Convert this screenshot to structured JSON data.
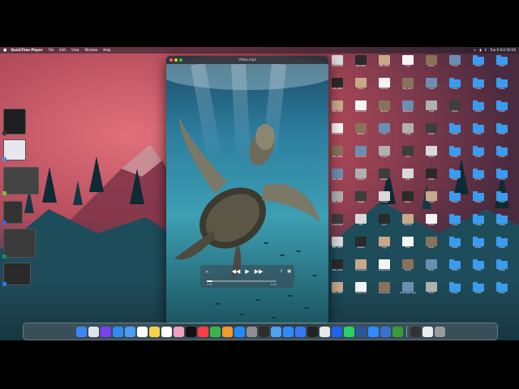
{
  "menubar": {
    "app_name": "QuickTime Player",
    "items": [
      "File",
      "Edit",
      "View",
      "Window",
      "Help"
    ],
    "clock": "Tue 6 Oct 10:50"
  },
  "player": {
    "title": "Video.mp4",
    "time_elapsed": "0:00",
    "time_remaining": "-0:24"
  },
  "desktop_icons": [
    [
      "Screenshot",
      "IMG_0012",
      "IMG_0031",
      "Logo",
      "Poster",
      "Cover",
      "Folder",
      "Folder"
    ],
    [
      "IMG_0041",
      "Photo",
      "Portrait",
      "IMG_0111",
      "Chart",
      "Folder",
      "Folder",
      "Folder"
    ],
    [
      "IMG_0120",
      "Document",
      "Mockup",
      "Wallpaper",
      "Logo",
      "Photo",
      "Folder",
      "Folder"
    ],
    [
      "Screenshot",
      "Picture",
      "Icon",
      "Image",
      "Photo",
      "Folder",
      "Folder",
      "Folder"
    ],
    [
      "IMG_0200",
      "Document",
      "Screen",
      "Icon",
      "Photo",
      "Folder",
      "Folder",
      "Folder"
    ],
    [
      "IMG_0218",
      "Artwork",
      "Render",
      "Scan",
      "Photo",
      "Folder",
      "Folder",
      "Folder"
    ],
    [
      "IMG_0250",
      "Image",
      "Image",
      "Movie",
      "Photo",
      "Folder",
      "Folder",
      "Folder"
    ],
    [
      "Screenshot",
      "Doc",
      "Icon",
      "Mockup",
      "Photo",
      "Folder",
      "Folder",
      "Folder"
    ],
    [
      "IMG_0301",
      "Screen",
      "Logo",
      "Scan",
      "Photo",
      "Folder",
      "Folder",
      "Folder"
    ],
    [
      "IMG_0333",
      "Screenshot",
      "Screenshot",
      "Movie",
      "Photo",
      "Folder",
      "Folder",
      "Folder"
    ],
    [
      "IMG_0350",
      "Screenshot",
      "Screenshot",
      "Fade Away.mp4",
      "Photo",
      "Folder",
      "Folder",
      "Folder"
    ]
  ],
  "dock_items": [
    "finder-icon",
    "launchpad-icon",
    "siri-icon",
    "safari-icon",
    "mail-icon",
    "calendar-icon",
    "notes-icon",
    "reminders-icon",
    "photos-icon",
    "tv-icon",
    "music-icon",
    "numbers-icon",
    "pages-icon",
    "appstore-icon",
    "settings-icon",
    "activity-icon",
    "preview-icon",
    "zoom-icon",
    "keynote-icon",
    "terminal-icon",
    "chrome-icon",
    "docker-icon",
    "whatsapp-icon",
    "word-icon",
    "zoom2-icon",
    "shield-icon",
    "vim-icon",
    "arrow-icon",
    "pen-icon",
    "trash-icon"
  ],
  "colors": {
    "accent": "#3a9cf0"
  }
}
